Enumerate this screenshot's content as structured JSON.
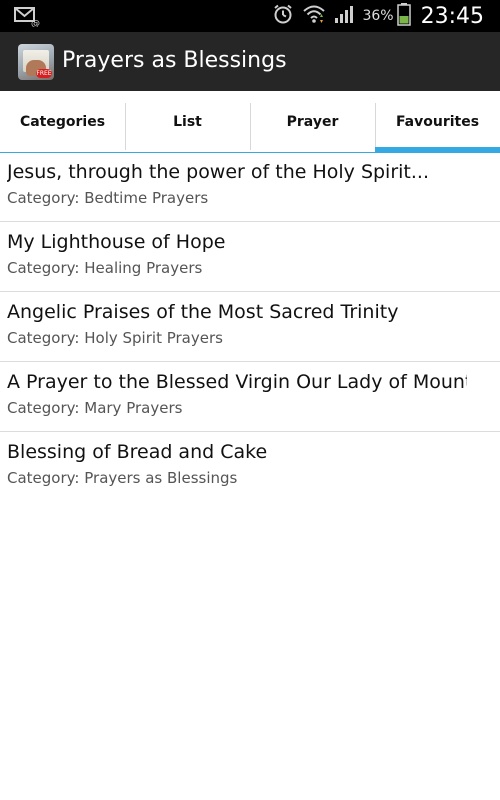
{
  "status_bar": {
    "battery_percent": "36%",
    "time": "23:45",
    "icons": [
      "email-icon",
      "alarm-icon",
      "wifi-icon",
      "signal-icon",
      "battery-icon"
    ]
  },
  "action_bar": {
    "title": "Prayers as Blessings",
    "icon_badge": "FREE"
  },
  "tabs": [
    {
      "label": "Categories",
      "selected": false
    },
    {
      "label": "List",
      "selected": false
    },
    {
      "label": "Prayer",
      "selected": false
    },
    {
      "label": "Favourites",
      "selected": true
    }
  ],
  "favourites": [
    {
      "title": "Jesus, through the power of the Holy Spirit...",
      "category": "Category: Bedtime Prayers"
    },
    {
      "title": "My Lighthouse of Hope",
      "category": "Category: Healing Prayers"
    },
    {
      "title": "Angelic Praises of the Most Sacred Trinity",
      "category": "Category: Holy Spirit Prayers"
    },
    {
      "title": "A Prayer to the Blessed Virgin Our Lady of Mount…",
      "category": "Category: Mary Prayers"
    },
    {
      "title": "Blessing of Bread and Cake",
      "category": "Category: Prayers as Blessings"
    }
  ],
  "colors": {
    "accent": "#35a9e1",
    "action_bar": "#262626",
    "status_bar": "#000000"
  }
}
